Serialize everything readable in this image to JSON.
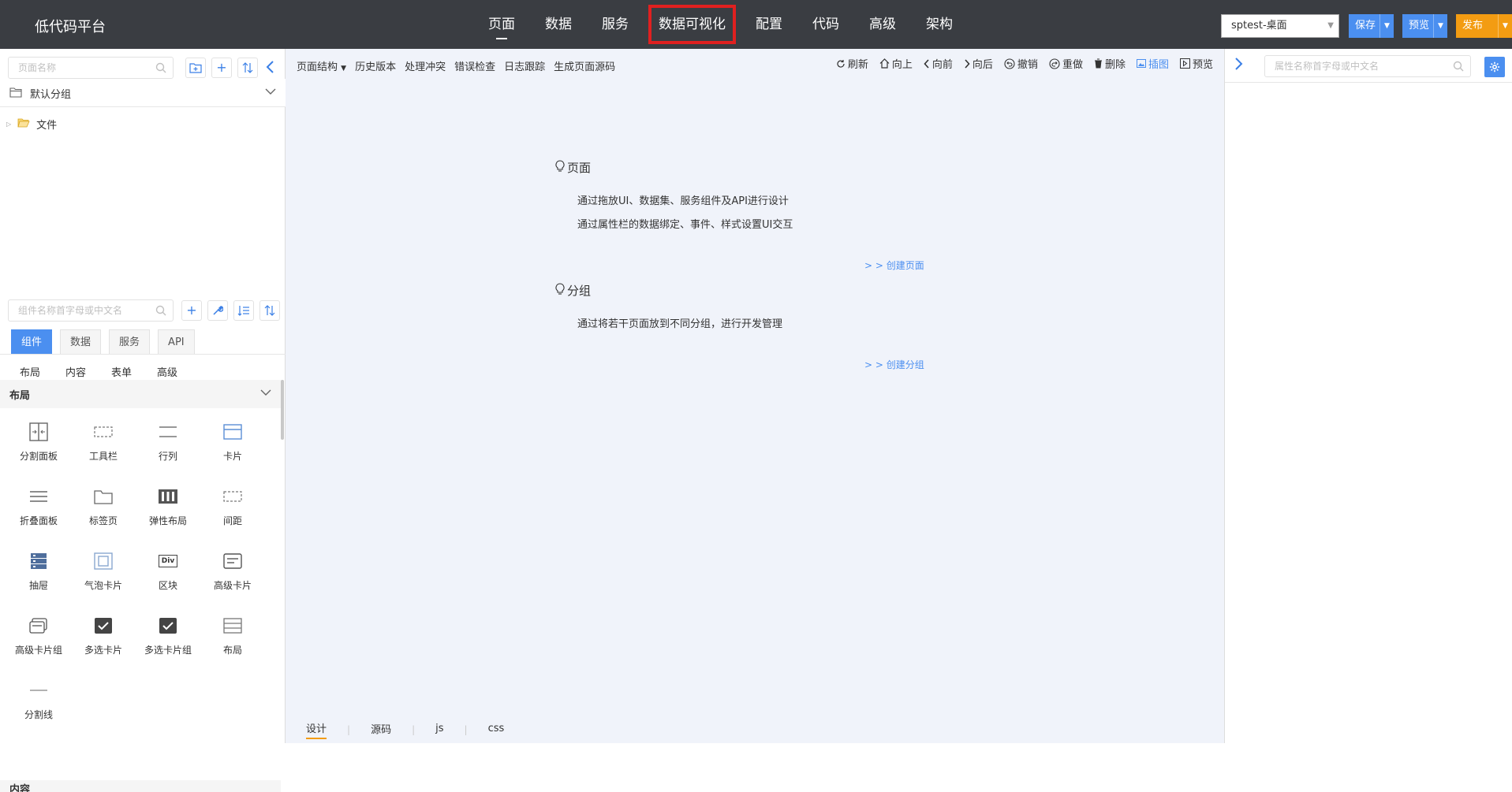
{
  "app": {
    "title": "低代码平台"
  },
  "nav": {
    "items": [
      "页面",
      "数据",
      "服务",
      "数据可视化",
      "配置",
      "代码",
      "高级",
      "架构"
    ]
  },
  "header": {
    "env_select": "sptest-桌面",
    "save_label": "保存",
    "preview_label": "预览",
    "publish_label": "发布"
  },
  "sidebar": {
    "page_search_placeholder": "页面名称",
    "group_title": "默认分组",
    "tree_item": "文件",
    "comp_search_placeholder": "组件名称首字母或中文名",
    "tabs": [
      "组件",
      "数据",
      "服务",
      "API"
    ],
    "subtabs": [
      "布局",
      "内容",
      "表单",
      "高级"
    ],
    "section_title": "布局",
    "section2_title": "内容",
    "components": [
      {
        "label": "分割面板",
        "icon": "split-panel-icon"
      },
      {
        "label": "工具栏",
        "icon": "toolbar-icon"
      },
      {
        "label": "行列",
        "icon": "row-column-icon"
      },
      {
        "label": "卡片",
        "icon": "card-icon"
      },
      {
        "label": "折叠面板",
        "icon": "collapse-panel-icon"
      },
      {
        "label": "标签页",
        "icon": "tabs-icon"
      },
      {
        "label": "弹性布局",
        "icon": "flex-layout-icon"
      },
      {
        "label": "间距",
        "icon": "spacing-icon"
      },
      {
        "label": "抽屉",
        "icon": "drawer-icon"
      },
      {
        "label": "气泡卡片",
        "icon": "bubble-card-icon"
      },
      {
        "label": "区块",
        "icon": "div-block-icon"
      },
      {
        "label": "高级卡片",
        "icon": "advanced-card-icon"
      },
      {
        "label": "高级卡片组",
        "icon": "advanced-card-group-icon"
      },
      {
        "label": "多选卡片",
        "icon": "multi-select-card-icon"
      },
      {
        "label": "多选卡片组",
        "icon": "multi-select-card-group-icon"
      },
      {
        "label": "布局",
        "icon": "layout-icon"
      },
      {
        "label": "分割线",
        "icon": "divider-icon"
      }
    ],
    "div_icon_text": "Div"
  },
  "toolbar": {
    "left": [
      "页面结构",
      "历史版本",
      "处理冲突",
      "错误检查",
      "日志跟踪",
      "生成页面源码"
    ],
    "right": [
      {
        "label": "刷新",
        "icon": "refresh-icon"
      },
      {
        "label": "向上",
        "icon": "home-icon"
      },
      {
        "label": "向前",
        "icon": "chevron-left-icon"
      },
      {
        "label": "向后",
        "icon": "chevron-right-icon"
      },
      {
        "label": "撤销",
        "icon": "undo-icon"
      },
      {
        "label": "重做",
        "icon": "redo-icon"
      },
      {
        "label": "删除",
        "icon": "trash-icon"
      },
      {
        "label": "插图",
        "icon": "image-icon"
      },
      {
        "label": "预览",
        "icon": "preview-icon"
      }
    ]
  },
  "help": {
    "page_title": "页面",
    "page_lines": [
      "通过拖放UI、数据集、服务组件及API进行设计",
      "通过属性栏的数据绑定、事件、样式设置UI交互"
    ],
    "page_link": "> > 创建页面",
    "group_title": "分组",
    "group_lines": [
      "通过将若干页面放到不同分组，进行开发管理"
    ],
    "group_link": "> > 创建分组"
  },
  "bottom_tabs": [
    "设计",
    "源码",
    "js",
    "css"
  ],
  "right_panel": {
    "search_placeholder": "属性名称首字母或中文名"
  },
  "colors": {
    "accent": "#4b8ff0",
    "publish": "#f39c12",
    "topbar": "#3a3d42",
    "highlight": "#e02020"
  }
}
